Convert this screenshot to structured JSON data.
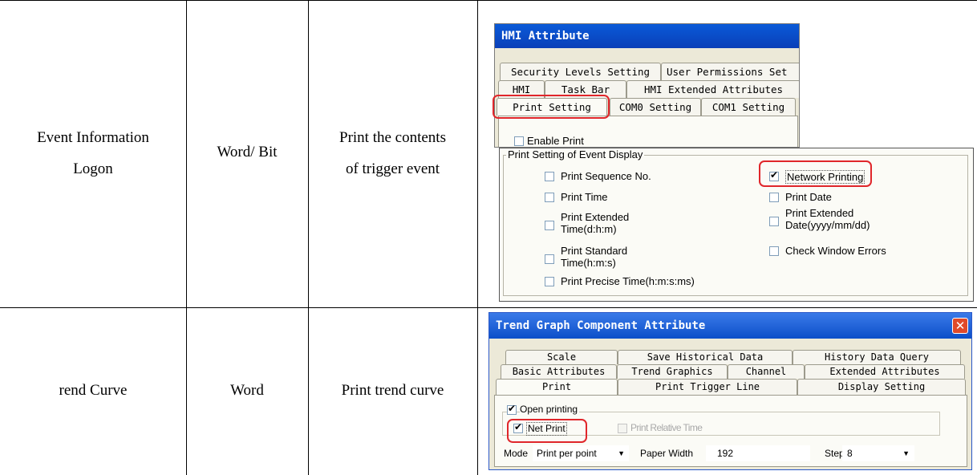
{
  "rows": [
    {
      "event": "Event Information Logon",
      "event_line1": "Event Information",
      "event_line2": "Logon",
      "data_type": "Word/ Bit",
      "desc_line1": "Print the contents",
      "desc_line2": "of trigger event",
      "dialog": {
        "title": "HMI Attribute",
        "tabs_row1": [
          "Security Levels Setting",
          "User Permissions Set"
        ],
        "tabs_row2": [
          "HMI",
          "Task Bar",
          "HMI Extended Attributes"
        ],
        "tabs_row3": [
          "Print Setting",
          "COM0 Setting",
          "COM1 Setting"
        ],
        "enable_print": "Enable Print",
        "group_title": "Print Setting of Event Display",
        "options_left": [
          "Print Sequence No.",
          "Print Time",
          "Print Extended Time(d:h:m)",
          "Print Standard Time(h:m:s)",
          "Print Precise Time(h:m:s:ms)"
        ],
        "options_right": [
          "Network Printing",
          "Print Date",
          "Print Extended Date(yyyy/mm/dd)",
          "Check Window Errors"
        ]
      }
    },
    {
      "event": "rend Curve",
      "data_type": "Word",
      "desc": "Print trend curve",
      "dialog": {
        "title": "Trend Graph Component Attribute",
        "tabs_row1": [
          "Scale",
          "Save Historical Data",
          "History Data Query"
        ],
        "tabs_row2": [
          "Basic Attributes",
          "Trend Graphics",
          "Channel",
          "Extended Attributes"
        ],
        "tabs_row3": [
          "Print",
          "Print Trigger Line",
          "Display Setting"
        ],
        "open_printing": "Open printing",
        "net_print": "Net Print",
        "print_relative_time": "Print Relative Time",
        "mode_label": "Mode",
        "mode_value": "Print per point",
        "paper_width_label": "Paper Width",
        "paper_width_value": "192",
        "step_label": "Step",
        "step_value": "8"
      }
    }
  ],
  "colors": {
    "highlight": "#e0262b",
    "xp_title": "#0a5ad8",
    "dialog_bg": "#ece9d8"
  }
}
